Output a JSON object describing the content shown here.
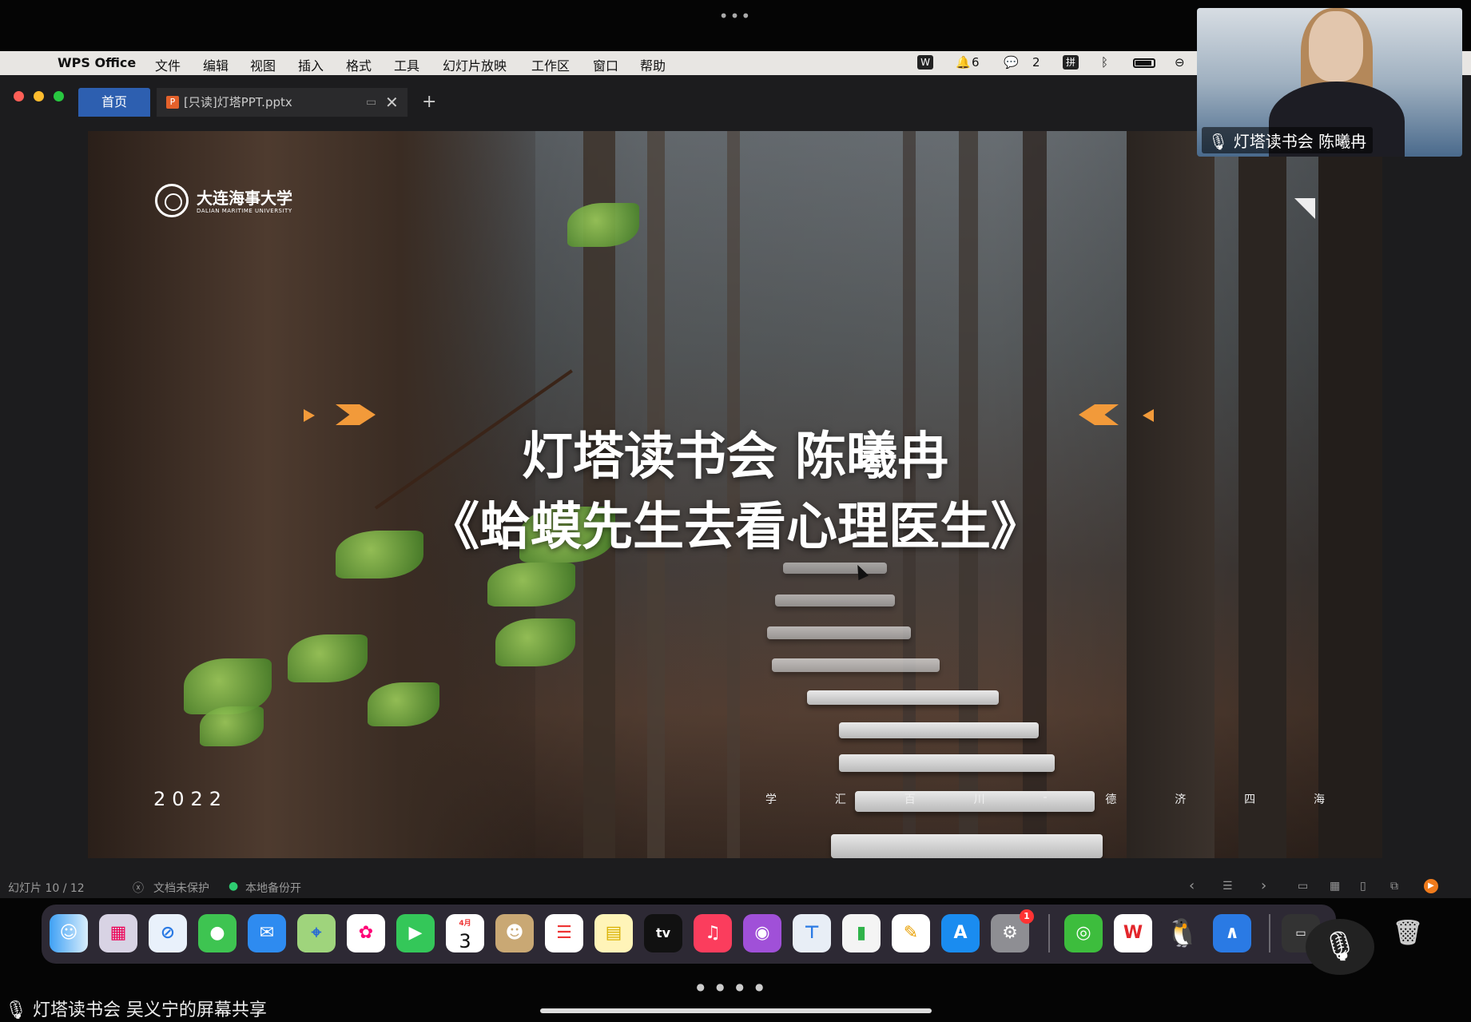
{
  "top_indicator": "•••",
  "menubar": {
    "app": "WPS Office",
    "items": [
      "文件",
      "编辑",
      "视图",
      "插入",
      "格式",
      "工具",
      "幻灯片放映",
      "工作区",
      "窗口",
      "帮助"
    ],
    "status": {
      "notify_count": "6",
      "wechat_count": "2"
    }
  },
  "tabs": {
    "home": "首页",
    "doc": "[只读]灯塔PPT.pptx",
    "add": "+"
  },
  "slide": {
    "logo_cn": "大连海事大学",
    "logo_en": "DALIAN MARITIME UNIVERSITY",
    "title_line1": "灯塔读书会  陈曦冉",
    "title_line2": "《蛤蟆先生去看心理医生》",
    "year": "2022",
    "motto": [
      "学",
      "汇",
      "百",
      "川",
      "-",
      "德",
      "济",
      "四",
      "海"
    ]
  },
  "video": {
    "label": "灯塔读书会 陈曦冉"
  },
  "statusbar": {
    "slide_counter": "幻灯片 10 / 12",
    "protect": "文档未保护",
    "backup": "本地备份开"
  },
  "dock": {
    "calendar_month": "4月",
    "calendar_day": "3",
    "tv_label": "tv",
    "settings_badge": "1",
    "wps_label": "W"
  },
  "bottom": {
    "page_dots": "●●●●",
    "share_label": "灯塔读书会 吴义宁的屏幕共享"
  },
  "colors": {
    "accent_tab": "#2d5fb0",
    "chevron": "#f29a3a",
    "menubar_bg": "#e8e6e3"
  }
}
